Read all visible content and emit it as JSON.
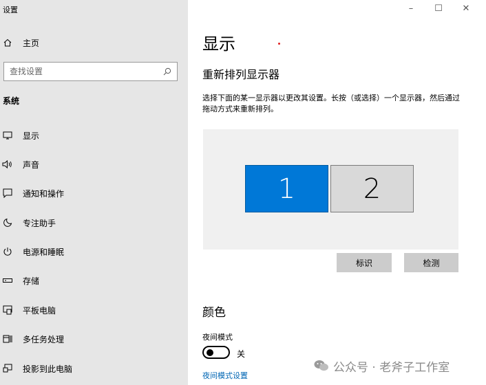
{
  "window": {
    "app_title": "设置",
    "minimize": "–",
    "maximize": "☐",
    "close": "✕"
  },
  "sidebar": {
    "home_label": "主页",
    "search_placeholder": "查找设置",
    "section_label": "系统",
    "items": [
      {
        "label": "显示",
        "icon": "monitor-icon"
      },
      {
        "label": "声音",
        "icon": "speaker-icon"
      },
      {
        "label": "通知和操作",
        "icon": "notification-icon"
      },
      {
        "label": "专注助手",
        "icon": "moon-icon"
      },
      {
        "label": "电源和睡眠",
        "icon": "power-icon"
      },
      {
        "label": "存储",
        "icon": "storage-icon"
      },
      {
        "label": "平板电脑",
        "icon": "tablet-icon"
      },
      {
        "label": "多任务处理",
        "icon": "multitask-icon"
      },
      {
        "label": "投影到此电脑",
        "icon": "project-icon"
      }
    ]
  },
  "main": {
    "title": "显示",
    "section_title": "重新排列显示器",
    "description": "选择下面的某一显示器以更改其设置。长按（或选择）一个显示器，然后通过拖动方式来重新排列。",
    "monitors": [
      {
        "label": "1",
        "selected": true
      },
      {
        "label": "2",
        "selected": false
      }
    ],
    "identify_button": "标识",
    "detect_button": "检测",
    "color_title": "颜色",
    "night_light_label": "夜间模式",
    "night_light_state": "关",
    "night_light_on": false,
    "night_light_link": "夜间模式设置"
  },
  "watermark": {
    "text": "公众号 · 老斧子工作室"
  },
  "colors": {
    "sidebar_bg": "#e6e6e6",
    "accent": "#0078d7",
    "link": "#0066b4"
  }
}
